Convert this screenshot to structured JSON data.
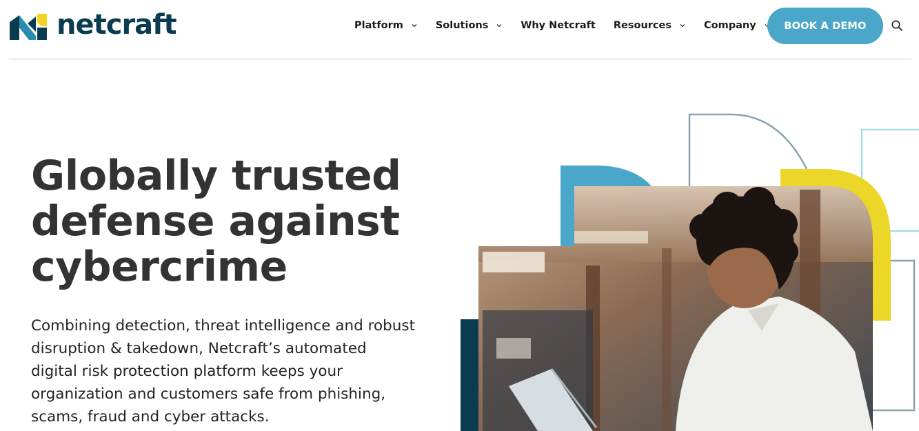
{
  "brand": {
    "name": "netcraft",
    "colors": {
      "navy": "#0b3b4f",
      "teal": "#2a8bb0",
      "yellow": "#f3d51f",
      "accent": "#4aa7c9"
    }
  },
  "nav": {
    "items": [
      {
        "label": "Platform",
        "has_dropdown": true
      },
      {
        "label": "Solutions",
        "has_dropdown": true
      },
      {
        "label": "Why Netcraft",
        "has_dropdown": false
      },
      {
        "label": "Resources",
        "has_dropdown": true
      },
      {
        "label": "Company",
        "has_dropdown": true
      }
    ],
    "cta_label": "BOOK A DEMO",
    "search_icon": "search-icon"
  },
  "hero": {
    "headline": [
      "Globally trusted",
      "defense against",
      "cybercrime"
    ],
    "body": "Combining detection, threat intelligence and robust disruption & takedown, Netcraft’s automated digital risk protection platform keeps your organization and customers safe from phishing, scams, fraud and cyber attacks.",
    "image": "photo-person-working-on-laptop"
  }
}
